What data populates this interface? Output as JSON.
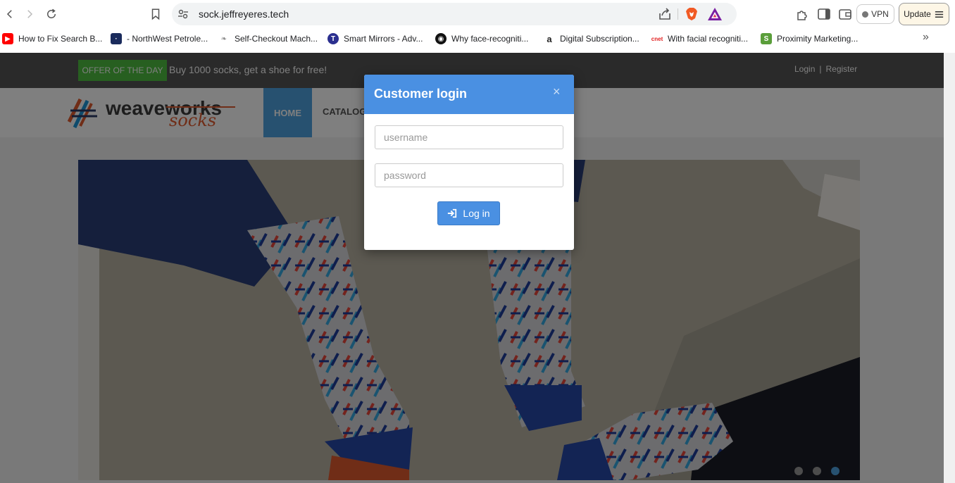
{
  "browser": {
    "url": "sock.jeffreyeres.tech",
    "vpn_label": "VPN",
    "update_label": "Update",
    "bookmarks": [
      {
        "label": "How to Fix Search B...",
        "icon": "youtube-icon",
        "color": "#ff0000"
      },
      {
        "label": "- NorthWest Petrole...",
        "icon": "starfield-icon",
        "color": "#1a2b5c"
      },
      {
        "label": "Self-Checkout Mach...",
        "icon": "leaf-icon",
        "color": "#888888"
      },
      {
        "label": "Smart Mirrors - Adv...",
        "icon": "t-circle-icon",
        "color": "#2b2f8f"
      },
      {
        "label": "Why face-recogniti...",
        "icon": "eye-circle-icon",
        "color": "#111111"
      },
      {
        "label": "Digital Subscription...",
        "icon": "amazon-icon",
        "color": "#ff9900"
      },
      {
        "label": "With facial recogniti...",
        "icon": "cnet-icon",
        "color": "#e22222"
      },
      {
        "label": "Proximity Marketing...",
        "icon": "shopify-icon",
        "color": "#5a9e3a"
      }
    ],
    "more_label": "»"
  },
  "site": {
    "offer_badge": "OFFER OF THE DAY",
    "offer_text": "Buy 1000 socks, get a shoe for free!",
    "login_link": "Login",
    "separator": "|",
    "register_link": "Register",
    "logo_main": "weaveworks",
    "logo_sub": "socks",
    "nav": {
      "home": "HOME",
      "catalogue": "CATALOG"
    },
    "carousel_slides": 3,
    "carousel_active": 3
  },
  "modal": {
    "title": "Customer login",
    "close": "×",
    "username_placeholder": "username",
    "password_placeholder": "password",
    "login_button": "Log in"
  },
  "colors": {
    "accent": "#4a90e2",
    "offer_green": "#4fbf40",
    "topbar": "#555555"
  }
}
